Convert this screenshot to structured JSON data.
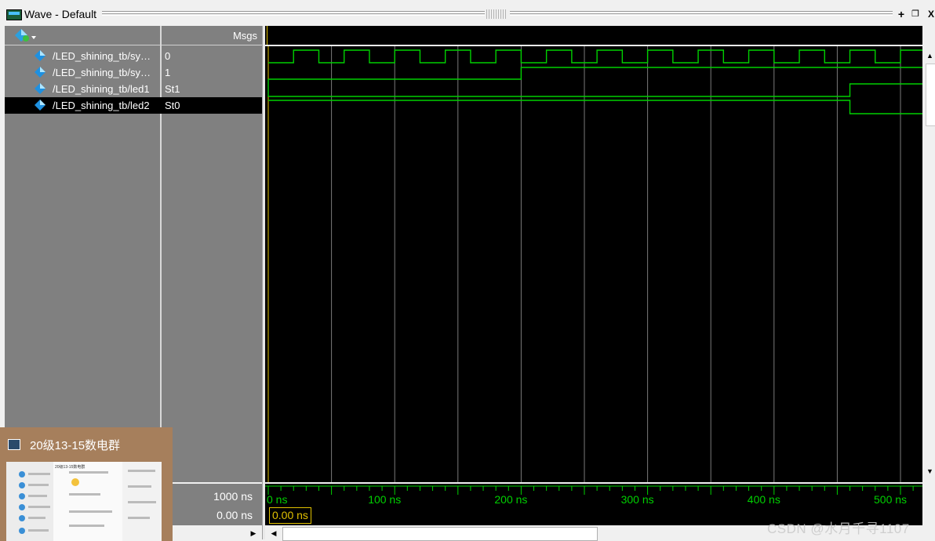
{
  "window": {
    "title": "Wave - Default",
    "buttons": [
      "+",
      "❐",
      "X"
    ]
  },
  "columns": {
    "msgs_header": "Msgs"
  },
  "signals": [
    {
      "name": "/LED_shining_tb/sy…",
      "value": "0",
      "selected": false
    },
    {
      "name": "/LED_shining_tb/sy…",
      "value": "1",
      "selected": false
    },
    {
      "name": "/LED_shining_tb/led1",
      "value": "St1",
      "selected": false
    },
    {
      "name": "/LED_shining_tb/led2",
      "value": "St0",
      "selected": true
    }
  ],
  "icons": {
    "toolbar": "signal-group-dropdown-icon",
    "signal": "diamond-signal-icon"
  },
  "colors": {
    "wave": "#00d000",
    "grid": "#7a7a7a",
    "cursor": "#e0c000",
    "timeline_text": "#00d000",
    "background": "#000000"
  },
  "time": {
    "now": "1000 ns",
    "cursor_value": "0.00 ns",
    "cursor_box": "0.00 ns",
    "ticks": [
      "0 ns",
      "100 ns",
      "200 ns",
      "300 ns",
      "400 ns",
      "500 ns"
    ],
    "visible_range_ns": [
      0,
      520
    ]
  },
  "waves": {
    "clk_period_ns": 40,
    "clk_first_rise_ns": 20,
    "sig2_toggles_ns": [
      200
    ],
    "led1_toggles_ns": [
      460
    ],
    "led2_toggles_ns": [
      460
    ]
  },
  "popup": {
    "title": "20级13-15数电群",
    "thumbnail_header": "20级13-15数电群"
  },
  "watermark": "CSDN @水月千寻1107"
}
